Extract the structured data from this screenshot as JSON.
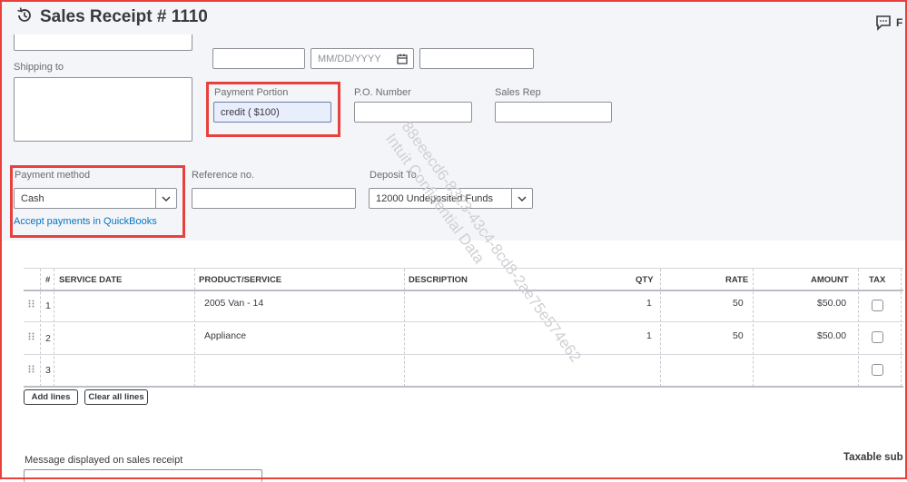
{
  "header": {
    "title": "Sales Receipt # 1110",
    "feedback_label": "F"
  },
  "form": {
    "shipping_to_label": "Shipping to",
    "shipping_date_placeholder": "MM/DD/YYYY",
    "payment_portion_label": "Payment Portion",
    "payment_portion_value": "credit ( $100)",
    "po_number_label": "P.O. Number",
    "sales_rep_label": "Sales Rep",
    "payment_method_label": "Payment method",
    "payment_method_value": "Cash",
    "accept_payments_link": "Accept payments in QuickBooks",
    "reference_label": "Reference no.",
    "deposit_to_label": "Deposit To",
    "deposit_to_value": "12000 Undeposited Funds"
  },
  "watermark": {
    "line1": "88eeecd6-8323-43c4-8cd8-2ae75e574e62",
    "line2": "Intuit Confidential Data"
  },
  "table": {
    "headers": [
      "#",
      "SERVICE DATE",
      "PRODUCT/SERVICE",
      "DESCRIPTION",
      "QTY",
      "RATE",
      "AMOUNT",
      "TAX"
    ],
    "rows": [
      {
        "num": "1",
        "service_date": "",
        "product": "2005 Van - 14",
        "description": "",
        "qty": "1",
        "rate": "50",
        "amount": "$50.00"
      },
      {
        "num": "2",
        "service_date": "",
        "product": "Appliance",
        "description": "",
        "qty": "1",
        "rate": "50",
        "amount": "$50.00"
      },
      {
        "num": "3",
        "service_date": "",
        "product": "",
        "description": "",
        "qty": "",
        "rate": "",
        "amount": ""
      }
    ]
  },
  "buttons": {
    "add_lines": "Add lines",
    "clear_all_lines": "Clear all lines"
  },
  "footer": {
    "message_label": "Message displayed on sales receipt",
    "taxable_subtotal_label": "Taxable sub"
  },
  "colors": {
    "highlight": "#e8413d",
    "link": "#0077c5",
    "selected_input": "#e8eefb"
  }
}
